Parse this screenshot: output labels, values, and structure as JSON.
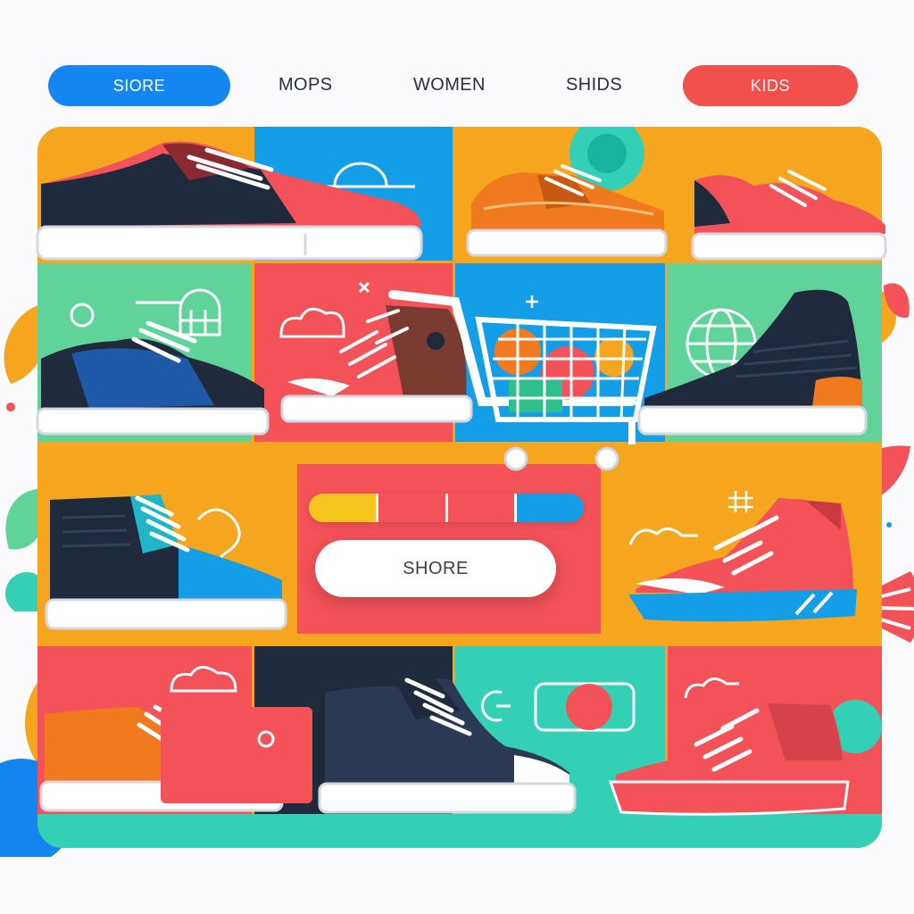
{
  "nav": {
    "store_label": "SIORE",
    "men_label": "MOPS",
    "women_label": "WOMEN",
    "shoes_label": "SHIDS",
    "kids_label": "KIDS"
  },
  "search": {
    "label": "SHORE"
  },
  "colors": {
    "store_pill": "#1386f2",
    "kids_pill": "#f2504c",
    "orange": "#f6a51e",
    "red": "#f25258",
    "blue": "#159ee8",
    "teal": "#34d0b6",
    "green": "#5fd39a",
    "navy": "#1f2a3d"
  },
  "products": [
    {
      "name": "low-top-red-navy-sneaker"
    },
    {
      "name": "orange-low-sneaker"
    },
    {
      "name": "coral-slip-sneaker"
    },
    {
      "name": "navy-blue-sneaker"
    },
    {
      "name": "red-brown-high-top"
    },
    {
      "name": "navy-chelsea-boot"
    },
    {
      "name": "navy-teal-high-top"
    },
    {
      "name": "red-blue-sole-sneaker"
    },
    {
      "name": "orange-high-top"
    },
    {
      "name": "navy-canvas-high-top"
    },
    {
      "name": "red-high-top"
    }
  ],
  "icons": [
    "cart-icon",
    "globe-icon",
    "cloud-icon",
    "house-icon",
    "hash-icon",
    "leaf-icon",
    "sparkle-icon"
  ]
}
